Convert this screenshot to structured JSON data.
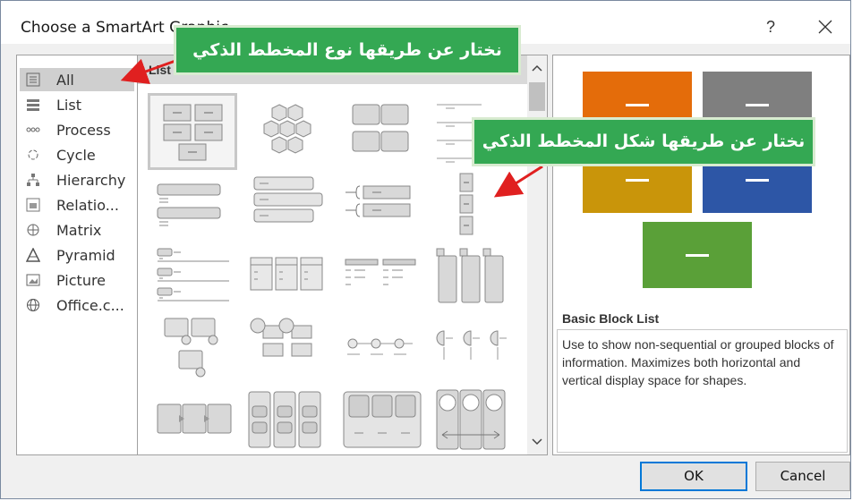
{
  "dialog": {
    "title": "Choose a SmartArt Graphic",
    "help_label": "?",
    "close_icon": "close-icon"
  },
  "categories": [
    {
      "label": "All",
      "icon": "all-icon",
      "selected": true
    },
    {
      "label": "List",
      "icon": "list-icon"
    },
    {
      "label": "Process",
      "icon": "process-icon"
    },
    {
      "label": "Cycle",
      "icon": "cycle-icon"
    },
    {
      "label": "Hierarchy",
      "icon": "hierarchy-icon"
    },
    {
      "label": "Relatio...",
      "icon": "relationship-icon"
    },
    {
      "label": "Matrix",
      "icon": "matrix-icon"
    },
    {
      "label": "Pyramid",
      "icon": "pyramid-icon"
    },
    {
      "label": "Picture",
      "icon": "picture-icon"
    },
    {
      "label": "Office.c...",
      "icon": "globe-icon"
    }
  ],
  "gallery": {
    "header": "List"
  },
  "preview": {
    "name": "Basic Block List",
    "description": "Use to show non-sequential or grouped blocks of information. Maximizes both horizontal and vertical display space for shapes.",
    "colors": {
      "orange": "#e46c0a",
      "gray": "#7f7f7f",
      "gold": "#c9950a",
      "blue": "#2d56a6",
      "green": "#5aa038"
    }
  },
  "buttons": {
    "ok": "OK",
    "cancel": "Cancel"
  },
  "annotations": {
    "callout_type": "نختار عن طريقها نوع المخطط الذكي",
    "callout_shape": "نختار عن طريقها شكل المخطط الذكي",
    "callout_color": "#34a853",
    "arrow_color": "#e02020"
  }
}
